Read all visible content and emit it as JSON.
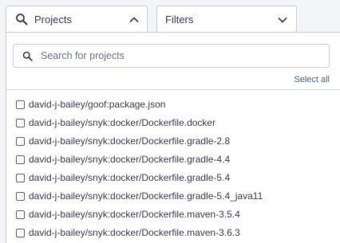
{
  "toolbar": {
    "projects_label": "Projects",
    "filters_label": "Filters"
  },
  "dropdown": {
    "search_placeholder": "Search for projects",
    "search_value": "",
    "select_all_label": "Select all",
    "items": [
      {
        "label": "david-j-bailey/goof:package.json",
        "checked": false
      },
      {
        "label": "david-j-bailey/snyk:docker/Dockerfile.docker",
        "checked": false
      },
      {
        "label": "david-j-bailey/snyk:docker/Dockerfile.gradle-2.8",
        "checked": false
      },
      {
        "label": "david-j-bailey/snyk:docker/Dockerfile.gradle-4.4",
        "checked": false
      },
      {
        "label": "david-j-bailey/snyk:docker/Dockerfile.gradle-5.4",
        "checked": false
      },
      {
        "label": "david-j-bailey/snyk:docker/Dockerfile.gradle-5.4_java11",
        "checked": false
      },
      {
        "label": "david-j-bailey/snyk:docker/Dockerfile.maven-3.5.4",
        "checked": false
      },
      {
        "label": "david-j-bailey/snyk:docker/Dockerfile.maven-3.6.3",
        "checked": false
      }
    ]
  },
  "icons": {
    "projects_search": "search-icon",
    "projects_chevron": "chevron-up-icon",
    "filters_chevron": "chevron-down-icon",
    "dropdown_search": "search-icon"
  },
  "colors": {
    "background": "#f4f5f8",
    "border": "#c9ccd6",
    "text": "#343a4d",
    "link": "#3a5fa8"
  }
}
